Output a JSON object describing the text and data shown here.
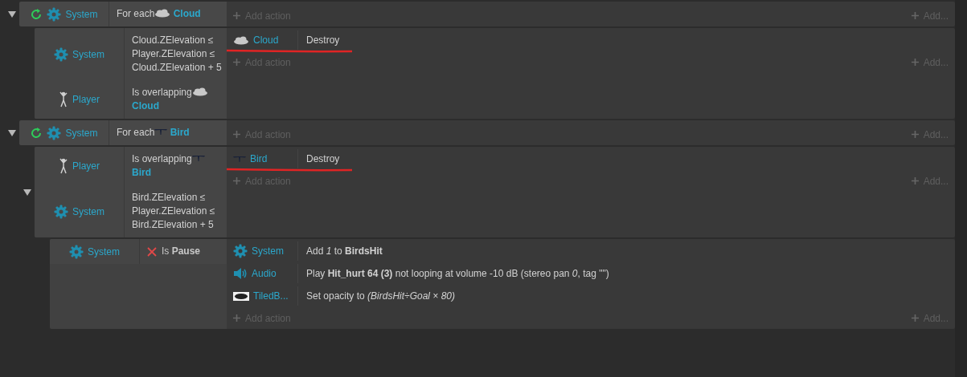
{
  "events": [
    {
      "expanded": true,
      "conditions": [
        {
          "looping": true,
          "inverted": false,
          "object": "System",
          "kind": "system",
          "text": "For each",
          "param": {
            "kind": "cloud",
            "name": "Cloud"
          }
        }
      ],
      "add_action": "Add action",
      "add_more": "Add...",
      "children": [
        {
          "conditions": [
            {
              "looping": false,
              "inverted": false,
              "object": "System",
              "kind": "system",
              "text": "Cloud.ZElevation ≤ Player.ZElevation ≤ Cloud.ZElevation + 5"
            },
            {
              "looping": false,
              "inverted": false,
              "object": "Player",
              "kind": "player",
              "text": "Is overlapping",
              "param": {
                "kind": "cloud",
                "name": "Cloud"
              }
            }
          ],
          "actions": [
            {
              "object": "Cloud",
              "kind": "cloud",
              "text": "Destroy",
              "underlined": true
            }
          ],
          "add_action": "Add action",
          "add_more": "Add..."
        }
      ]
    },
    {
      "expanded": true,
      "conditions": [
        {
          "looping": true,
          "inverted": false,
          "object": "System",
          "kind": "system",
          "text": "For each",
          "param": {
            "kind": "bird",
            "name": "Bird"
          }
        }
      ],
      "add_action": "Add action",
      "add_more": "Add...",
      "children": [
        {
          "expanded": true,
          "conditions": [
            {
              "looping": false,
              "inverted": false,
              "object": "Player",
              "kind": "player",
              "text": "Is overlapping",
              "param": {
                "kind": "bird",
                "name": "Bird"
              }
            },
            {
              "looping": false,
              "inverted": false,
              "object": "System",
              "kind": "system",
              "text": "Bird.ZElevation ≤ Player.ZElevation ≤ Bird.ZElevation + 5"
            }
          ],
          "actions": [
            {
              "object": "Bird",
              "kind": "bird",
              "text": "Destroy",
              "underlined": true
            }
          ],
          "add_action": "Add action",
          "add_more": "Add...",
          "children": [
            {
              "conditions": [
                {
                  "looping": false,
                  "inverted": true,
                  "object": "System",
                  "kind": "system",
                  "text": "Is **Pause**"
                }
              ],
              "actions": [
                {
                  "object": "System",
                  "kind": "system",
                  "text": "Add *1* to **BirdsHit**",
                  "underlined": false
                },
                {
                  "object": "Audio",
                  "kind": "audio",
                  "text": "Play **Hit_hurt 64 (3)** not looping at volume -10 dB (stereo pan *0*, tag \"\")",
                  "underlined": false
                },
                {
                  "object": "TiledB...",
                  "kind": "tiled",
                  "text": "Set opacity to *(BirdsHit÷Goal × 80)*",
                  "underlined": false
                }
              ],
              "add_action": "Add action",
              "add_more": "Add..."
            }
          ]
        }
      ]
    }
  ]
}
